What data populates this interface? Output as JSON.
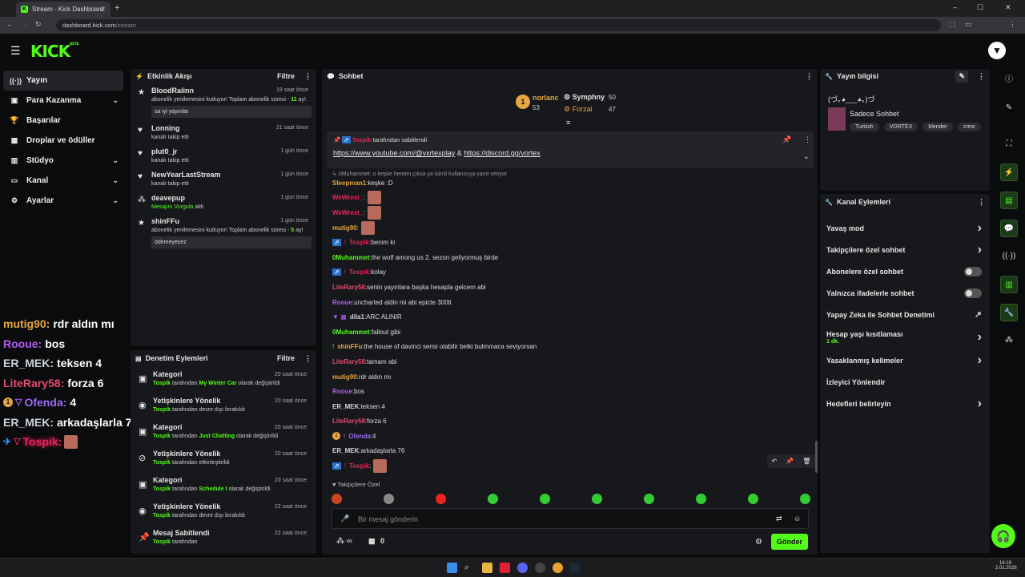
{
  "browser": {
    "tab_title": "Stream - Kick Dashboard",
    "url_host": "dashboard.kick.com",
    "url_path": "/stream"
  },
  "app": {
    "logo": "KICK",
    "logo_badge": "BETA"
  },
  "nav": {
    "items": [
      {
        "label": "Yayın",
        "icon": "broadcast-icon"
      },
      {
        "label": "Para Kazanma",
        "icon": "wallet-icon"
      },
      {
        "label": "Başarılar",
        "icon": "trophy-icon"
      },
      {
        "label": "Droplar ve ödüller",
        "icon": "gift-icon"
      },
      {
        "label": "Stüdyo",
        "icon": "layout-icon"
      },
      {
        "label": "Kanal",
        "icon": "tv-icon"
      },
      {
        "label": "Ayarlar",
        "icon": "gear-icon"
      }
    ]
  },
  "overlay_chat": [
    {
      "user": "mutig90:",
      "text": "rdr aldın mı",
      "color": "#e8a640"
    },
    {
      "user": "Rooue:",
      "text": "bos",
      "color": "#b45cf5"
    },
    {
      "user": "ER_MEK:",
      "text": "teksen 4",
      "color": "#cfd4da"
    },
    {
      "user": "LiteRary58:",
      "text": "forza 6",
      "color": "#e34b6f"
    },
    {
      "user": "Ofenda:",
      "text": "4",
      "color": "#9b6bf5"
    },
    {
      "user": "ER_MEK:",
      "text": "arkadaşlarla 76",
      "color": "#cfd4da"
    },
    {
      "user": "Tospik:",
      "text": "",
      "color": "#e8245a"
    }
  ],
  "activity": {
    "title": "Etkinlik Akışı",
    "filter": "Filtre",
    "items": [
      {
        "name": "BloodRaiinn",
        "time": "19 saat önce",
        "sub": "abonelik yenilemesini kutluyor! Toplam abonelik süresi",
        "months": "11",
        "months_suffix": "ay!",
        "message": "sa iyi yayınlar"
      },
      {
        "name": "Lonning",
        "time": "21 saat önce",
        "sub": "kanalı takip etti"
      },
      {
        "name": "plut0_jr",
        "time": "1 gün önce",
        "sub": "kanalı takip etti"
      },
      {
        "name": "NewYearLastStream",
        "time": "1 gün önce",
        "sub": "kanalı takip etti"
      },
      {
        "name": "deavepup",
        "time": "1 gün önce",
        "sub_green": "Mesajını Vurgula",
        "sub": "aldı"
      },
      {
        "name": "shinFFu",
        "time": "1 gün önce",
        "sub": "abonelik yenilemesini kutluyor! Toplam abonelik süresi",
        "months": "5",
        "months_suffix": "ay!",
        "message": "ödemeyecez"
      }
    ]
  },
  "moderation": {
    "title": "Denetim Eylemleri",
    "filter": "Filtre",
    "items": [
      {
        "title": "Kategori",
        "time": "20 saat önce",
        "user": "Tospik",
        "pre": "tarafından",
        "hl": "My Winter Car",
        "post": "olarak değiştirildi"
      },
      {
        "title": "Yetişkinlere Yönelik",
        "time": "20 saat önce",
        "user": "Tospik",
        "pre": "tarafından devre dışı bırakıldı",
        "hl": "",
        "post": ""
      },
      {
        "title": "Kategori",
        "time": "20 saat önce",
        "user": "Tospik",
        "pre": "tarafından",
        "hl": "Just Chatting",
        "post": "olarak değiştirildi"
      },
      {
        "title": "Yetişkinlere Yönelik",
        "time": "20 saat önce",
        "user": "Tospik",
        "pre": "tarafından etkinleştirildi",
        "hl": "",
        "post": ""
      },
      {
        "title": "Kategori",
        "time": "20 saat önce",
        "user": "Tospik",
        "pre": "tarafından",
        "hl": "Schedule I",
        "post": "olarak değiştirildi"
      },
      {
        "title": "Yetişkinlere Yönelik",
        "time": "22 saat önce",
        "user": "Tospik",
        "pre": "tarafından devre dışı bırakıldı",
        "hl": "",
        "post": ""
      },
      {
        "title": "Mesaj Sabitlendi",
        "time": "22 saat önce",
        "user": "Tospik",
        "pre": "tarafından",
        "hl": "",
        "post": ""
      }
    ]
  },
  "chat": {
    "title": "Sohbet",
    "leaderboard": [
      {
        "name": "norlanc",
        "score": "53"
      },
      {
        "name": "Symphny",
        "score": "50"
      },
      {
        "name": "Forzai",
        "score": "47"
      }
    ],
    "pinned": {
      "by": "Tospik",
      "by_suffix": "tarafından sabitlendi",
      "link1": "https://www.youtube.com/@vxrtexplay",
      "amp": "&",
      "link2": "https://discord.gg/vortex"
    },
    "reply_note": "0Muhammet: o keşke hemen çıksa ya isimli kullanıcıya yanıt veriyor",
    "messages": [
      {
        "user": "Sleepman1",
        "text": "keşke :D",
        "color": "#e8a640"
      },
      {
        "user": "WeWrest_",
        "text": "",
        "color": "#e8245a",
        "emote": true
      },
      {
        "user": "WeWrest_",
        "text": "",
        "color": "#e8245a",
        "emote": true
      },
      {
        "user": "mutig90",
        "text": "",
        "color": "#e8a640",
        "emote": true
      },
      {
        "user": "Tospik",
        "text": "benim ki",
        "color": "#e8245a"
      },
      {
        "user": "0Muhammet",
        "text": "the wolf among us 2. sezon geliyormuş birde",
        "color": "#53fc18"
      },
      {
        "user": "Tospik",
        "text": "kolay",
        "color": "#e8245a"
      },
      {
        "user": "LiteRary58",
        "text": "senin yayınlara başka hesapla gelcem abi",
        "color": "#e34b6f"
      },
      {
        "user": "Rooue",
        "text": "uncharted aldin mi abi epicte 300tl",
        "color": "#b45cf5"
      },
      {
        "user": "dila1",
        "text": "ARC ALINIR",
        "color": "#cfd4da"
      },
      {
        "user": "0Muhammet",
        "text": "fallout gibi",
        "color": "#53fc18"
      },
      {
        "user": "shinFFu",
        "text": "the house of davinci serisi olabilir belki bulmmaca seviyorsan",
        "color": "#e8a640"
      },
      {
        "user": "LiteRary58",
        "text": "tamam abi",
        "color": "#e34b6f"
      },
      {
        "user": "mutig90",
        "text": "rdr aldın mı",
        "color": "#e8a640"
      },
      {
        "user": "Rooue",
        "text": "bos",
        "color": "#b45cf5"
      },
      {
        "user": "ER_MEK",
        "text": "teksen 4",
        "color": "#cfd4da"
      },
      {
        "user": "LiteRary58",
        "text": "forza 6",
        "color": "#e34b6f"
      },
      {
        "user": "Ofenda",
        "text": "4",
        "color": "#9b6bf5"
      },
      {
        "user": "ER_MEK",
        "text": "arkadaşlarla 76",
        "color": "#cfd4da"
      },
      {
        "user": "Tospik",
        "text": "",
        "color": "#e8245a",
        "emote": true
      }
    ],
    "emote_section": "Takipçilere Özel",
    "input_placeholder": "Bir mesaj gönderin",
    "points": "∞",
    "store_count": "0",
    "send": "Gönder"
  },
  "stream_info": {
    "title": "Yayın bilgisi",
    "stream_title": "(づ｡◕‿‿◕｡)づ",
    "category": "Sadece Sohbet",
    "tags": [
      "Turkish",
      "VORTEX",
      "blender",
      "crew"
    ]
  },
  "channel_actions": {
    "title": "Kanal Eylemleri",
    "items": [
      {
        "label": "Yavaş mod",
        "type": "arrow"
      },
      {
        "label": "Takipçilere özel sohbet",
        "type": "arrow"
      },
      {
        "label": "Abonelere özel sohbet",
        "type": "toggle"
      },
      {
        "label": "Yalnızca ifadelerle sohbet",
        "type": "toggle"
      },
      {
        "label": "Yapay Zeka ile Sohbet Denetimi",
        "type": "external"
      },
      {
        "label": "Hesap yaşı kısıtlaması",
        "type": "arrow",
        "value": "1 dk."
      },
      {
        "label": "Yasaklanmış kelimeler",
        "type": "arrow"
      },
      {
        "label": "İzleyici Yönlendir",
        "type": "none"
      },
      {
        "label": "Hedefleri belirleyin",
        "type": "arrow"
      }
    ]
  },
  "taskbar": {
    "time": "16:19",
    "date": "2.01.2026"
  }
}
